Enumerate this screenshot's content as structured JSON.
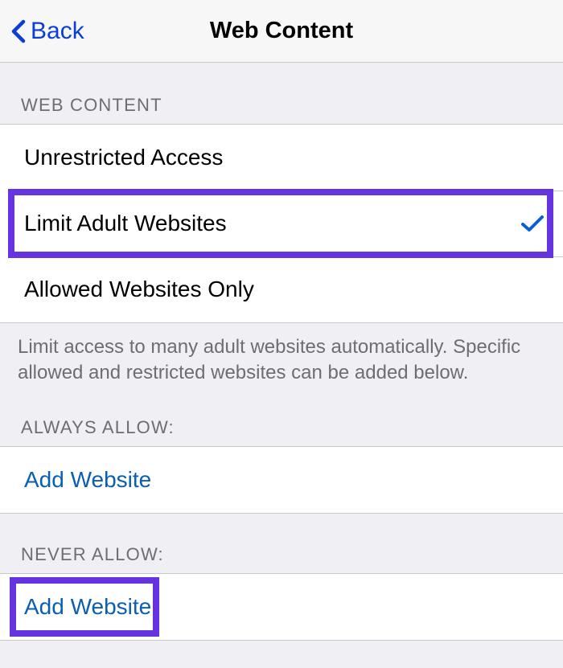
{
  "nav": {
    "back_label": "Back",
    "title": "Web Content"
  },
  "sections": {
    "web_content_header": "WEB CONTENT",
    "options": {
      "unrestricted": "Unrestricted Access",
      "limit_adult": "Limit Adult Websites",
      "allowed_only": "Allowed Websites Only"
    },
    "footer_text": "Limit access to many adult websites automatically. Specific allowed and restricted websites can be added below.",
    "always_allow_header": "ALWAYS ALLOW:",
    "always_allow_add": "Add Website",
    "never_allow_header": "NEVER ALLOW:",
    "never_allow_add": "Add Website"
  }
}
